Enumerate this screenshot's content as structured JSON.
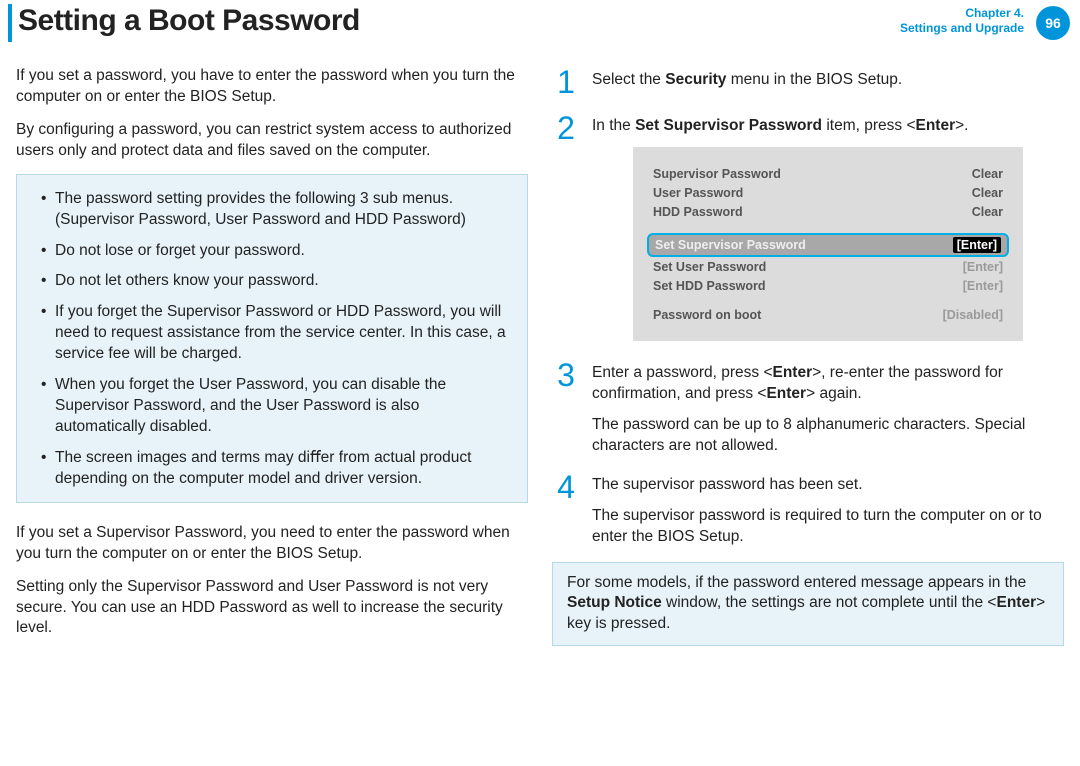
{
  "header": {
    "title": "Setting a Boot Password",
    "chapter_line1": "Chapter 4.",
    "chapter_line2": "Settings and Upgrade",
    "page_number": "96"
  },
  "left": {
    "p1": "If you set a password, you have to enter the password when you turn the computer on or enter the BIOS Setup.",
    "p2": "By conﬁguring a password, you can restrict system access to authorized users only and protect data and ﬁles saved on the computer.",
    "callout": {
      "items": [
        "The password setting provides the following 3 sub menus. (Supervisor Password, User Password and HDD Password)",
        "Do not lose or forget your password.",
        "Do not let others know your password.",
        "If you forget the Supervisor Password or HDD Password, you will need to request assistance from the service center. In this case, a service fee will be charged.",
        "When you forget the User Password, you can disable the Supervisor Password, and the User Password is also automatically disabled.",
        "The screen images and terms may diﬀer from actual product depending on the computer model and driver version."
      ]
    },
    "p3": "If you set a Supervisor Password, you need to enter the password when you turn the computer on or enter the BIOS Setup.",
    "p4": "Setting only the Supervisor Password and User Password is not very secure. You can use an HDD Password as well to increase the security level."
  },
  "right": {
    "step1": {
      "num": "1",
      "text_before": "Select the ",
      "bold": "Security",
      "text_after": " menu in the BIOS Setup."
    },
    "step2": {
      "num": "2",
      "text_before": "In the ",
      "bold": "Set Supervisor Password",
      "text_mid": " item, press <",
      "bold2": "Enter",
      "text_after": ">."
    },
    "bios": {
      "rows_top": [
        {
          "k": "Supervisor Password",
          "v": "Clear"
        },
        {
          "k": "User Password",
          "v": "Clear"
        },
        {
          "k": "HDD Password",
          "v": "Clear"
        }
      ],
      "highlight": {
        "k": "Set Supervisor Password",
        "v": "[Enter]"
      },
      "rows_mid": [
        {
          "k": "Set User Password",
          "v": "[Enter]"
        },
        {
          "k": "Set HDD Password",
          "v": "[Enter]"
        }
      ],
      "rows_bot": [
        {
          "k": "Password on boot",
          "v": "[Disabled]"
        }
      ]
    },
    "step3": {
      "num": "3",
      "p1_a": "Enter a password, press <",
      "p1_b1": "Enter",
      "p1_c": ">, re-enter the password for conﬁrmation, and press <",
      "p1_b2": "Enter",
      "p1_d": "> again.",
      "p2": "The password can be up to 8 alphanumeric characters. Special characters are not allowed."
    },
    "step4": {
      "num": "4",
      "p1": "The supervisor password has been set.",
      "p2": "The supervisor password is required to turn the computer on or to enter the BIOS Setup."
    },
    "note": {
      "a": "For some models, if the password entered message appears in the ",
      "bold": "Setup Notice",
      "b": " window, the settings are not complete until the <",
      "bold2": "Enter",
      "c": "> key is pressed."
    }
  }
}
